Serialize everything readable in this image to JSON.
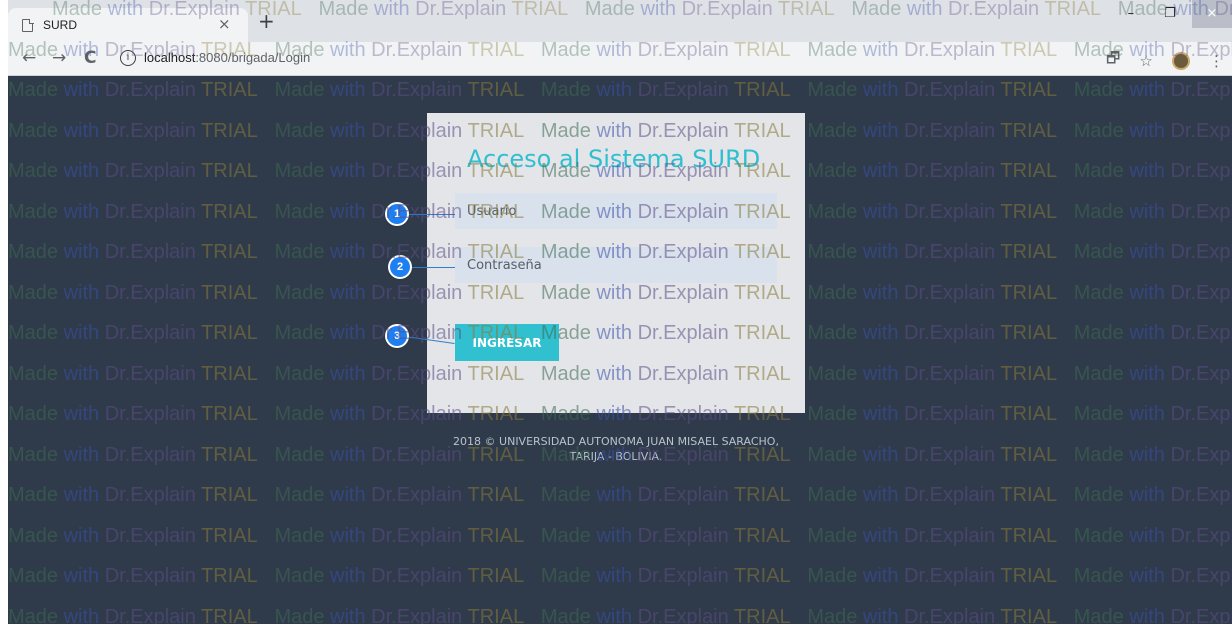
{
  "browser": {
    "tab_title": "SURD",
    "tab_close": "×",
    "new_tab": "+",
    "url_host": "localhost",
    "url_path": ":8080/brigada/Login",
    "info_glyph": "i",
    "back": "←",
    "forward": "→",
    "reload": "C",
    "win_min": "–",
    "win_max": "❐",
    "win_close": "×",
    "translate_icon": "🗗",
    "star": "☆",
    "menu": "⋮"
  },
  "watermark": {
    "made": "Made ",
    "with": "with ",
    "drexplain": "Dr.Explain ",
    "trial": "TRIAL"
  },
  "login": {
    "title": "Acceso al Sistema SURD",
    "username_placeholder": "Usuario",
    "password_placeholder": "Contraseña",
    "submit_label": "INGRESAR"
  },
  "footer": {
    "line1": "2018 © UNIVERSIDAD AUTONOMA JUAN MISAEL SARACHO,",
    "line2": "TARIJA - BOLIVIA."
  },
  "callouts": [
    "1",
    "2",
    "3"
  ],
  "colors": {
    "page_bg": "#2f3b4a",
    "accent": "#31c0cf",
    "callout": "#1e7ff0"
  }
}
